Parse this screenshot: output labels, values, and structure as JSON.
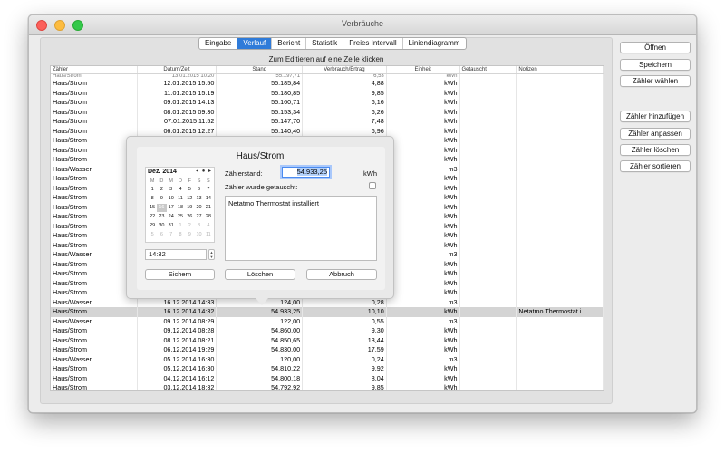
{
  "window": {
    "title": "Verbräuche"
  },
  "tabs": [
    {
      "label": "Eingabe",
      "active": false
    },
    {
      "label": "Verlauf",
      "active": true
    },
    {
      "label": "Bericht",
      "active": false
    },
    {
      "label": "Statistik",
      "active": false
    },
    {
      "label": "Freies Intervall",
      "active": false
    },
    {
      "label": "Liniendiagramm",
      "active": false
    }
  ],
  "edit_hint": "Zum Editieren auf eine Zeile klicken",
  "table": {
    "columns": [
      "Zähler",
      "Datum/Zeit",
      "Stand",
      "Verbrauch/Ertrag",
      "Einheit",
      "Getauscht",
      "Notizen"
    ],
    "partial_row": [
      "Haus/Strom",
      "13.01.2015 10:20",
      "55.197,71",
      "6,53",
      "kWh",
      "",
      ""
    ],
    "rows": [
      [
        "Haus/Strom",
        "12.01.2015 15:50",
        "55.185,84",
        "4,88",
        "kWh",
        "",
        ""
      ],
      [
        "Haus/Strom",
        "11.01.2015 15:19",
        "55.180,85",
        "9,85",
        "kWh",
        "",
        ""
      ],
      [
        "Haus/Strom",
        "09.01.2015 14:13",
        "55.160,71",
        "6,16",
        "kWh",
        "",
        ""
      ],
      [
        "Haus/Strom",
        "08.01.2015 09:30",
        "55.153,34",
        "6,26",
        "kWh",
        "",
        ""
      ],
      [
        "Haus/Strom",
        "07.01.2015 11:52",
        "55.147,70",
        "7,48",
        "kWh",
        "",
        ""
      ],
      [
        "Haus/Strom",
        "06.01.2015 12:27",
        "55.140,40",
        "6,96",
        "kWh",
        "",
        ""
      ],
      [
        "Haus/Strom",
        "",
        "",
        "",
        "kWh",
        "",
        ""
      ],
      [
        "Haus/Strom",
        "",
        "",
        "",
        "kWh",
        "",
        ""
      ],
      [
        "Haus/Strom",
        "",
        "",
        "",
        "kWh",
        "",
        ""
      ],
      [
        "Haus/Wasser",
        "",
        "",
        "",
        "m3",
        "",
        ""
      ],
      [
        "Haus/Strom",
        "",
        "",
        "",
        "kWh",
        "",
        ""
      ],
      [
        "Haus/Strom",
        "",
        "",
        "",
        "kWh",
        "",
        ""
      ],
      [
        "Haus/Strom",
        "",
        "",
        "",
        "kWh",
        "",
        ""
      ],
      [
        "Haus/Strom",
        "",
        "",
        "",
        "kWh",
        "",
        ""
      ],
      [
        "Haus/Strom",
        "",
        "",
        "",
        "kWh",
        "",
        ""
      ],
      [
        "Haus/Strom",
        "",
        "",
        "",
        "kWh",
        "",
        ""
      ],
      [
        "Haus/Strom",
        "",
        "",
        "",
        "kWh",
        "",
        ""
      ],
      [
        "Haus/Strom",
        "",
        "",
        "",
        "kWh",
        "",
        ""
      ],
      [
        "Haus/Wasser",
        "",
        "",
        "",
        "m3",
        "",
        ""
      ],
      [
        "Haus/Strom",
        "",
        "",
        "",
        "kWh",
        "",
        ""
      ],
      [
        "Haus/Strom",
        "",
        "",
        "",
        "kWh",
        "",
        ""
      ],
      [
        "Haus/Strom",
        "",
        "",
        "",
        "kWh",
        "",
        ""
      ],
      [
        "Haus/Strom",
        "",
        "",
        "",
        "kWh",
        "",
        ""
      ],
      [
        "Haus/Wasser",
        "16.12.2014 14:33",
        "124,00",
        "0,28",
        "m3",
        "",
        ""
      ],
      [
        "Haus/Strom",
        "16.12.2014 14:32",
        "54.933,25",
        "10,10",
        "kWh",
        "",
        "Netatmo Thermostat i..."
      ],
      [
        "Haus/Wasser",
        "09.12.2014 08:29",
        "122,00",
        "0,55",
        "m3",
        "",
        ""
      ],
      [
        "Haus/Strom",
        "09.12.2014 08:28",
        "54.860,00",
        "9,30",
        "kWh",
        "",
        ""
      ],
      [
        "Haus/Strom",
        "08.12.2014 08:21",
        "54.850,65",
        "13,44",
        "kWh",
        "",
        ""
      ],
      [
        "Haus/Strom",
        "06.12.2014 19:29",
        "54.830,00",
        "17,59",
        "kWh",
        "",
        ""
      ],
      [
        "Haus/Wasser",
        "05.12.2014 16:30",
        "120,00",
        "0,24",
        "m3",
        "",
        ""
      ],
      [
        "Haus/Strom",
        "05.12.2014 16:30",
        "54.810,22",
        "9,92",
        "kWh",
        "",
        ""
      ],
      [
        "Haus/Strom",
        "04.12.2014 16:12",
        "54.800,18",
        "8,04",
        "kWh",
        "",
        ""
      ],
      [
        "Haus/Strom",
        "03.12.2014 18:32",
        "54.792,92",
        "9,85",
        "kWh",
        "",
        ""
      ]
    ],
    "selected_row": 24
  },
  "sidebar": {
    "open": "Öffnen",
    "save": "Speichern",
    "choose_meter": "Zähler wählen",
    "add_meter": "Zähler hinzufügen",
    "edit_meter": "Zähler anpassen",
    "delete_meter": "Zähler löschen",
    "sort_meter": "Zähler sortieren"
  },
  "popover": {
    "title": "Haus/Strom",
    "calendar": {
      "month": "Dez. 2014",
      "nav": "◂ ● ▸",
      "weekdays": [
        "M",
        "D",
        "M",
        "D",
        "F",
        "S",
        "S"
      ],
      "days": [
        [
          "",
          "1",
          "2",
          "3",
          "4",
          "5",
          "6",
          "7"
        ],
        [
          "",
          "8",
          "9",
          "10",
          "11",
          "12",
          "13",
          "14"
        ],
        [
          "",
          "15",
          "16",
          "17",
          "18",
          "19",
          "20",
          "21"
        ],
        [
          "",
          "22",
          "23",
          "24",
          "25",
          "26",
          "27",
          "28"
        ],
        [
          "",
          "29",
          "30",
          "31",
          "1",
          "2",
          "3",
          "4"
        ],
        [
          "",
          "5",
          "6",
          "7",
          "8",
          "9",
          "10",
          "11"
        ]
      ],
      "selected_day": "16"
    },
    "time": "14:32",
    "reading_label": "Zählerstand:",
    "reading_value": "54.933,25",
    "unit": "kWh",
    "replaced_label": "Zähler wurde getauscht:",
    "note": "Netatmo Thermostat installiert",
    "save_button": "Sichern",
    "delete_button": "Löschen",
    "cancel_button": "Abbruch"
  }
}
